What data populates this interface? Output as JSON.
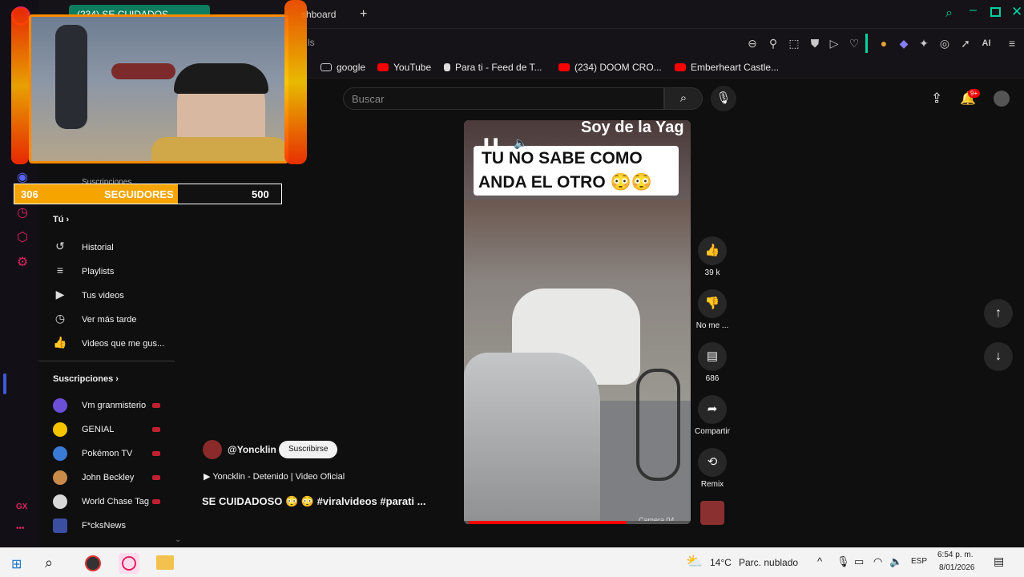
{
  "browser": {
    "tab_active": "(234) SE CUIDADOS…",
    "tab_2": "Dashboard",
    "tab_2_visible": "shboard",
    "new_tab": "+",
    "url_visible": "ls",
    "ai_label": "AI"
  },
  "bookmarks": [
    {
      "label": "google",
      "icon": "folder-icon"
    },
    {
      "label": "YouTube",
      "icon": "youtube-icon"
    },
    {
      "label": "Para ti - Feed de T...",
      "icon": "tiktok-icon"
    },
    {
      "label": "(234) DOOM CRO...",
      "icon": "youtube-icon"
    },
    {
      "label": "Emberheart Castle...",
      "icon": "youtube-icon"
    }
  ],
  "search": {
    "placeholder": "Buscar"
  },
  "notifications": {
    "badge": "9+"
  },
  "overlay": {
    "followers_current": "306",
    "followers_label": "SEGUIDORES",
    "followers_goal": "500",
    "progress_fraction": 0.612
  },
  "sidebar": {
    "partial_label": "Suscripciones",
    "you_label": "Tú",
    "you_arrow": "›",
    "items": [
      {
        "label": "Historial",
        "icon": "history-icon"
      },
      {
        "label": "Playlists",
        "icon": "playlist-icon"
      },
      {
        "label": "Tus videos",
        "icon": "video-icon"
      },
      {
        "label": "Ver más tarde",
        "icon": "clock-icon"
      },
      {
        "label": "Videos que me gus...",
        "icon": "like-icon"
      }
    ],
    "subs_label": "Suscripciones",
    "subs_arrow": "›",
    "subscriptions": [
      {
        "label": "Vm granmisterio",
        "color": "#6b4fd8"
      },
      {
        "label": "GENIAL",
        "color": "#f4c400"
      },
      {
        "label": "Pokémon TV",
        "color": "#3a7bd5"
      },
      {
        "label": "John Beckley",
        "color": "#c98a4a"
      },
      {
        "label": "World Chase Tag",
        "color": "#d8d8d8"
      },
      {
        "label": "F*cksNews",
        "color": "#3b4fa0"
      }
    ]
  },
  "gx": {
    "label": "GX",
    "more": "•••"
  },
  "short": {
    "caption_line1": "TU NO SABE COMO",
    "caption_line2": "ANDA EL OTRO 😳😳",
    "top_text": "Soy de la Yag",
    "watermark": "Camera 04",
    "channel": "@Yoncklin",
    "subscribe": "Suscribirse",
    "music": "Yoncklin - Detenido | Video Oficial",
    "title": "SE CUIDADOSO 😳 😳 #viralvideos #parati ...",
    "progress": 0.71
  },
  "actions": {
    "likes": "39 k",
    "dislike": "No me ...",
    "comments": "686",
    "share": "Compartir",
    "remix": "Remix"
  },
  "taskbar": {
    "temp": "14°C",
    "weather": "Parc. nublado",
    "lang": "ESP",
    "time": "6:54 p. m.",
    "date": "8/01/2026"
  }
}
